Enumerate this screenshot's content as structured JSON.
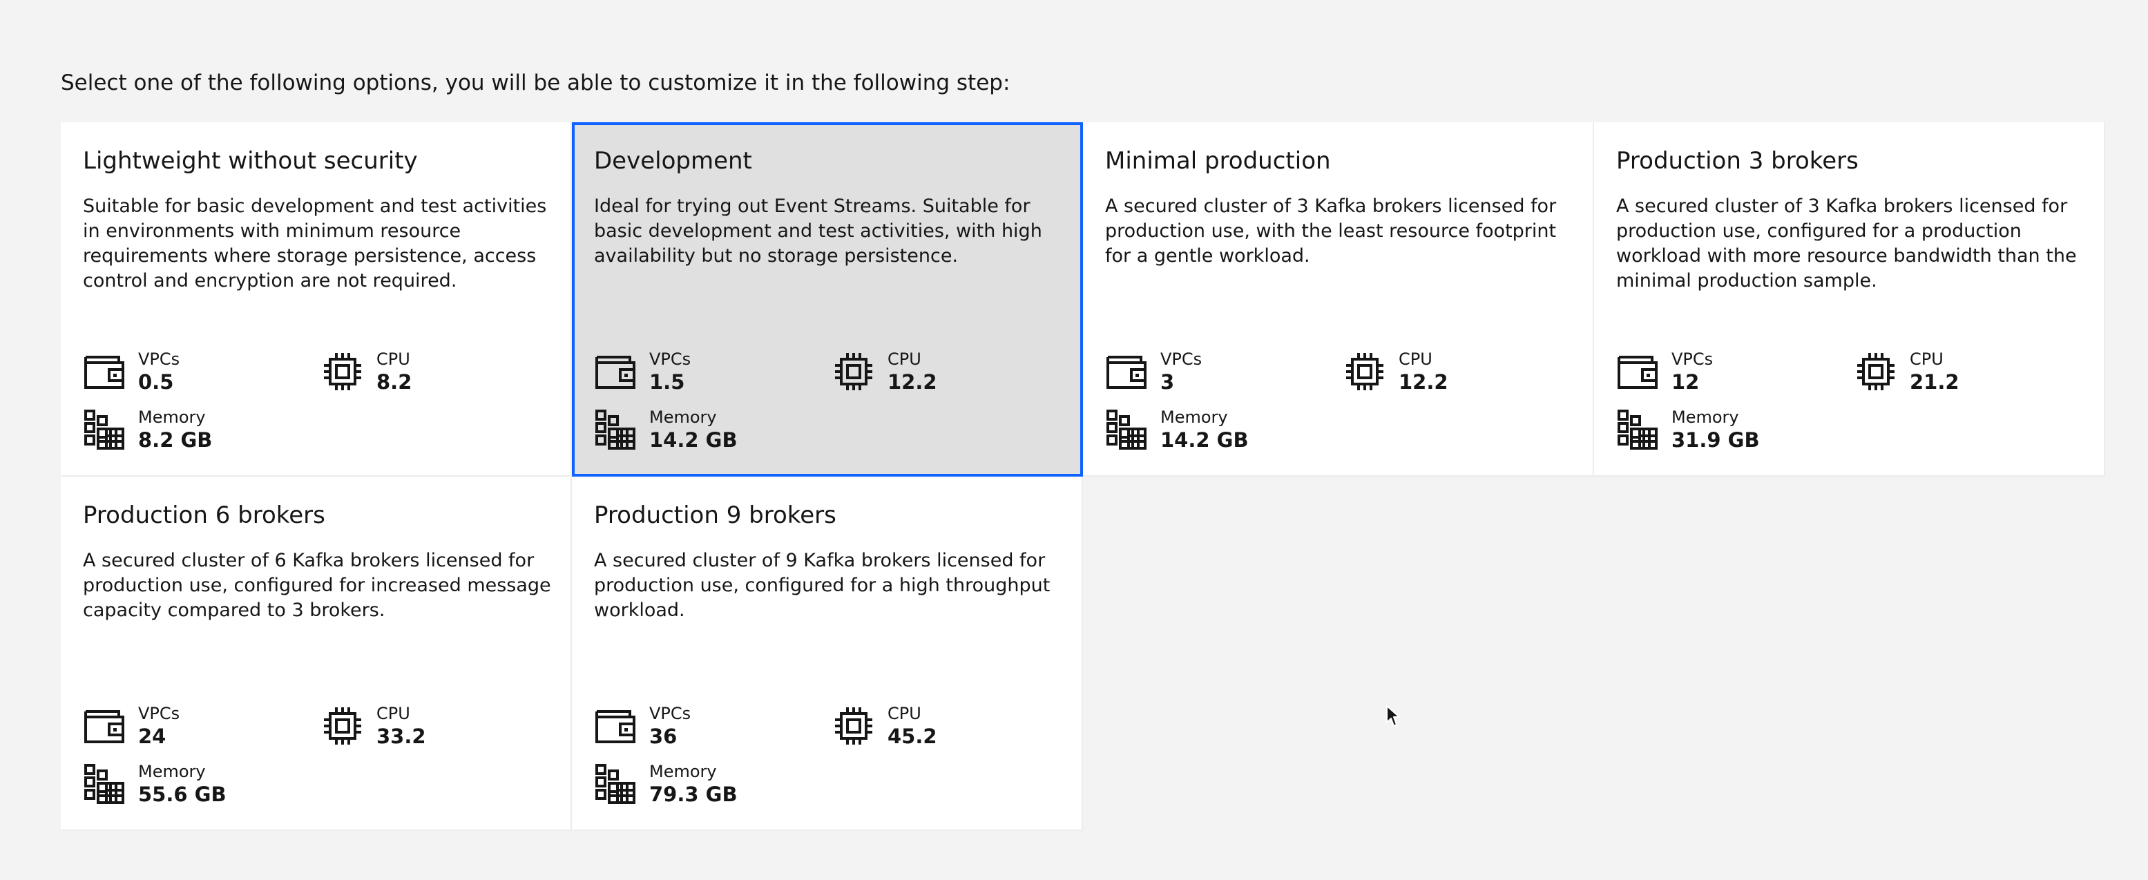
{
  "intro": "Select one of the following options, you will be able to customize it in the following step:",
  "labels": {
    "vpcs": "VPCs",
    "cpu": "CPU",
    "memory": "Memory"
  },
  "accent_color": "#0f62fe",
  "selected_tile": "Development",
  "tiles": [
    {
      "title": "Lightweight without security",
      "description": "Suitable for basic development and test activities in environments with minimum resource requirements where storage persistence, access control and encryption are not required.",
      "vpcs": "0.5",
      "cpu": "8.2",
      "memory": "8.2 GB"
    },
    {
      "title": "Development",
      "description": "Ideal for trying out Event Streams. Suitable for basic development and test activities, with high availability but no storage persistence.",
      "vpcs": "1.5",
      "cpu": "12.2",
      "memory": "14.2 GB"
    },
    {
      "title": "Minimal production",
      "description": "A secured cluster of 3 Kafka brokers licensed for production use, with the least resource footprint for a gentle workload.",
      "vpcs": "3",
      "cpu": "12.2",
      "memory": "14.2 GB"
    },
    {
      "title": "Production 3 brokers",
      "description": "A secured cluster of 3 Kafka brokers licensed for production use, configured for a production workload with more resource bandwidth than the minimal production sample.",
      "vpcs": "12",
      "cpu": "21.2",
      "memory": "31.9 GB"
    },
    {
      "title": "Production 6 brokers",
      "description": "A secured cluster of 6 Kafka brokers licensed for production use, configured for increased message capacity compared to 3 brokers.",
      "vpcs": "24",
      "cpu": "33.2",
      "memory": "55.6 GB"
    },
    {
      "title": "Production 9 brokers",
      "description": "A secured cluster of 9 Kafka brokers licensed for production use, configured for a high throughput workload.",
      "vpcs": "36",
      "cpu": "45.2",
      "memory": "79.3 GB"
    }
  ]
}
